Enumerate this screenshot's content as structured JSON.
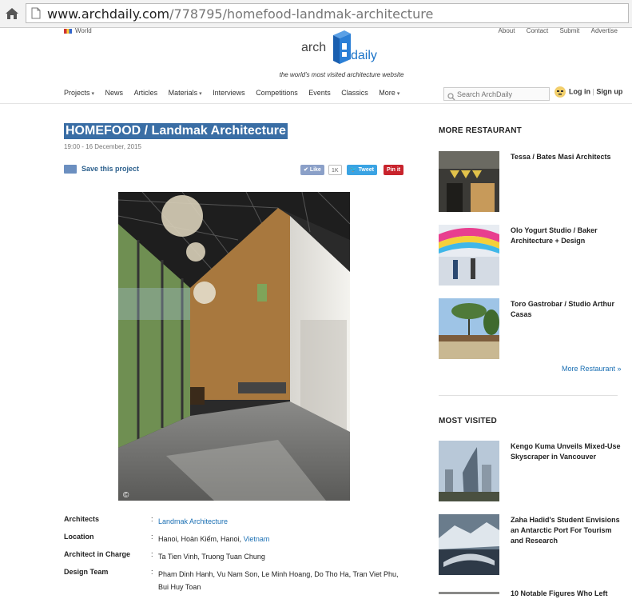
{
  "browser": {
    "url_host": "www.archdaily.com",
    "url_path": "/778795/homefood-landmak-architecture"
  },
  "topbar": {
    "region": "World",
    "links": [
      "About",
      "Contact",
      "Submit",
      "Advertise"
    ]
  },
  "logo": {
    "left": "arch",
    "right": "daily"
  },
  "tagline": "the world's most visited architecture website",
  "nav": {
    "items": [
      "Projects",
      "News",
      "Articles",
      "Materials",
      "Interviews",
      "Competitions",
      "Events",
      "Classics",
      "More"
    ],
    "search_placeholder": "Search ArchDaily",
    "login": "Log in",
    "signup": "Sign up"
  },
  "article": {
    "title": "HOMEFOOD / Landmak Architecture",
    "date": "19:00 - 16 December, 2015",
    "save_label": "Save this project",
    "like_label": "Like",
    "like_count": "1K",
    "tweet_label": "Tweet",
    "pin_label": "Pin it",
    "copyright": "©"
  },
  "details": [
    {
      "label": "Architects",
      "value": "Landmak Architecture",
      "link": true
    },
    {
      "label": "Location",
      "value": "Hanoi, Hoàn Kiếm, Hanoi, ",
      "value_link": "Vietnam"
    },
    {
      "label": "Architect in Charge",
      "value": "Ta Tien Vinh, Truong Tuan Chung"
    },
    {
      "label": "Design Team",
      "value": "Pham Dinh Hanh, Vu Nam Son, Le Minh Hoang, Do Tho Ha, Tran Viet Phu, Bui Huy Toan"
    }
  ],
  "sidebar": {
    "more_restaurant_heading": "MORE RESTAURANT",
    "restaurants": [
      "Tessa / Bates Masi Architects",
      "Olo Yogurt Studio / Baker Architecture + Design",
      "Toro Gastrobar / Studio Arthur Casas"
    ],
    "more_link": "More Restaurant »",
    "most_visited_heading": "MOST VISITED",
    "most_visited": [
      "Kengo Kuma Unveils Mixed-Use Skyscraper in Vancouver",
      "Zaha Hadid's Student Envisions an Antarctic Port For Tourism and Research",
      "10 Notable Figures Who Left"
    ]
  },
  "colors": {
    "link": "#1a6fb3",
    "selection": "#3a6ea5",
    "brand_blue": "#1a73c8"
  }
}
